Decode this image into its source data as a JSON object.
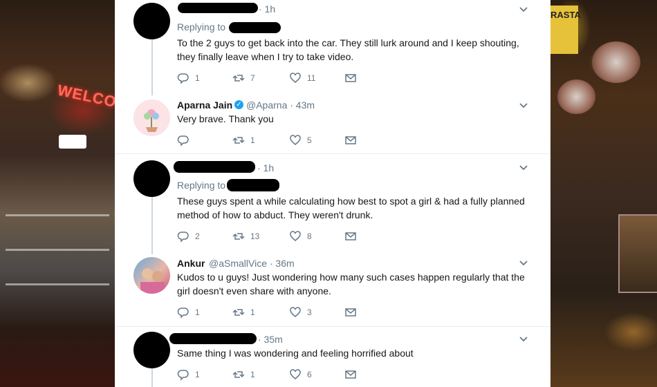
{
  "background": {
    "left_sign_text": "WELCOME",
    "right_sign_text": "RASTA"
  },
  "tweets": [
    {
      "author_name": "",
      "author_handle": "",
      "time": "· 1h",
      "replying_to": "Replying to",
      "text": "To the 2 guys to get back into the car. They still lurk around and I keep shouting, they finally leave when I try to take video.",
      "replies": "1",
      "retweets": "7",
      "likes": "11"
    },
    {
      "author_name": "Aparna Jain",
      "author_handle": "@Aparna · 43m",
      "verified": true,
      "text": "Very brave. Thank you",
      "replies": "",
      "retweets": "1",
      "likes": "5"
    },
    {
      "author_name": "",
      "author_handle": "",
      "time": "· 1h",
      "replying_to": "Replying to",
      "text": "These guys spent a while calculating how best to spot a girl & had a fully planned method of how to abduct. They weren't drunk.",
      "replies": "2",
      "retweets": "13",
      "likes": "8"
    },
    {
      "author_name": "Ankur",
      "author_handle": "@aSmallVice · 36m",
      "text": "Kudos to u guys! Just wondering how many such cases happen regularly that the girl doesn't even share with anyone.",
      "replies": "1",
      "retweets": "1",
      "likes": "3"
    },
    {
      "author_name": "",
      "author_handle": "",
      "time": "· 35m",
      "text": "Same thing I was wondering and feeling horrified about",
      "replies": "1",
      "retweets": "1",
      "likes": "6"
    }
  ],
  "colors": {
    "text": "#14171a",
    "secondary": "#657786",
    "verified": "#1da1f2",
    "divider": "#e6ecf0"
  }
}
